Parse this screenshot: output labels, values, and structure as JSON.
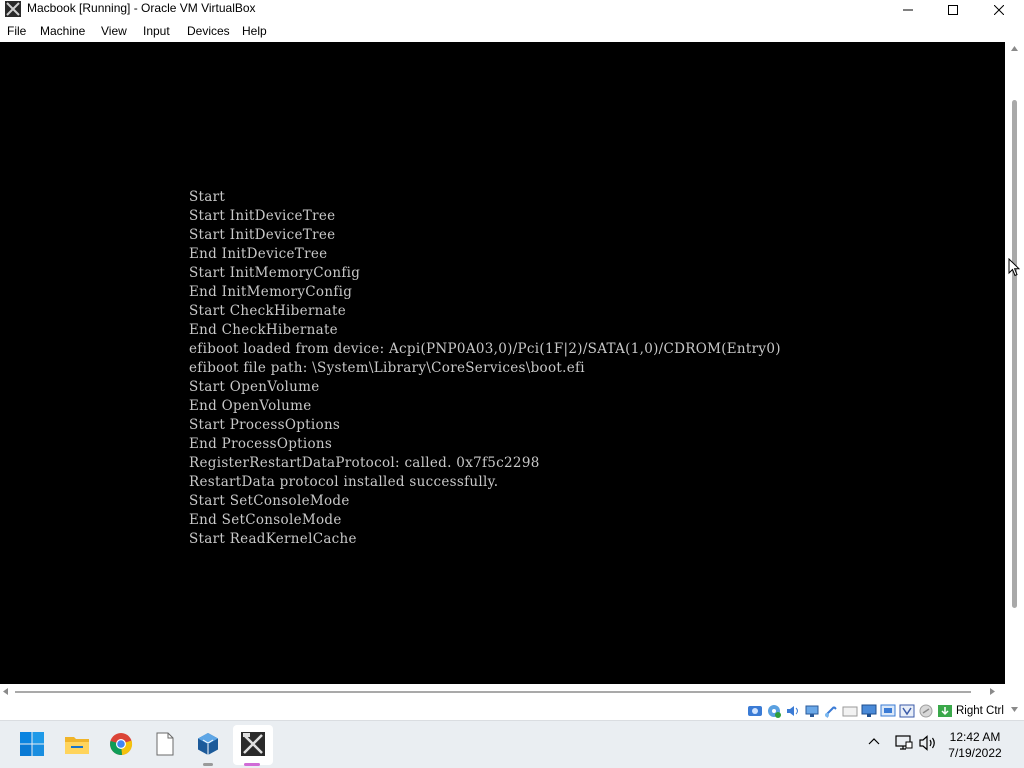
{
  "window": {
    "title": "Macbook [Running] - Oracle VM VirtualBox",
    "app_icon": "virtualbox-icon",
    "controls": [
      "minimize-icon",
      "maximize-icon",
      "close-icon"
    ]
  },
  "menubar": {
    "items": [
      "File",
      "Machine",
      "View",
      "Input",
      "Devices",
      "Help"
    ]
  },
  "console": {
    "lines": [
      "Start",
      "Start InitDeviceTree",
      "Start InitDeviceTree",
      "End InitDeviceTree",
      "Start InitMemoryConfig",
      "End InitMemoryConfig",
      "Start CheckHibernate",
      "End CheckHibernate",
      "efiboot loaded from device: Acpi(PNP0A03,0)/Pci(1F|2)/SATA(1,0)/CDROM(Entry0)",
      "efiboot file path: \\System\\Library\\CoreServices\\boot.efi",
      "Start OpenVolume",
      "End OpenVolume",
      "Start ProcessOptions",
      "End ProcessOptions",
      "RegisterRestartDataProtocol: called. 0x7f5c2298",
      "RestartData protocol installed successfully.",
      "Start SetConsoleMode",
      "End SetConsoleMode",
      "Start ReadKernelCache"
    ],
    "text_color": "#c8c8c8",
    "background": "#000000"
  },
  "statusbar": {
    "icons": [
      "hard-disk-icon",
      "optical-drive-icon",
      "audio-icon",
      "network-icon",
      "usb-icon",
      "shared-folders-icon",
      "display-icon",
      "recording-icon",
      "cpu-icon",
      "mouse-integration-icon",
      "keyboard-icon"
    ],
    "host_key": "Right Ctrl"
  },
  "taskbar": {
    "apps": [
      "windows-start-icon",
      "file-explorer-icon",
      "chrome-icon",
      "notepad-icon",
      "virtualbox-manager-icon",
      "virtualbox-vm-icon"
    ],
    "tray": [
      "chevron-up-icon",
      "network-icon",
      "volume-icon"
    ],
    "time": "12:42 AM",
    "date": "7/19/2022",
    "accent": "#0078d4"
  }
}
